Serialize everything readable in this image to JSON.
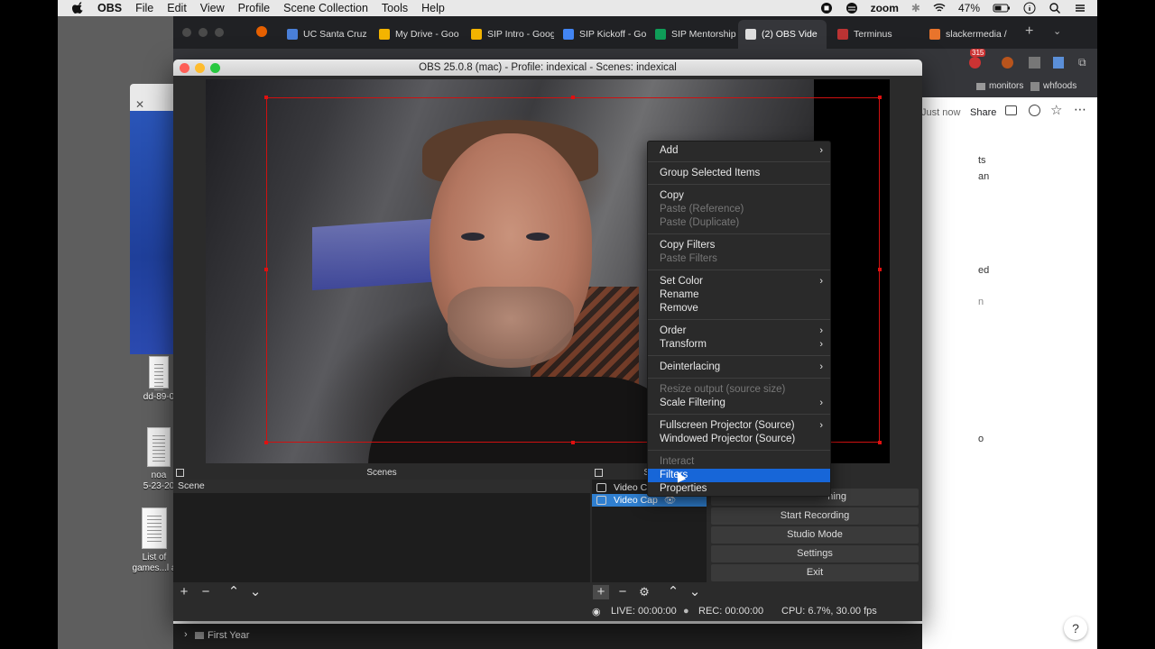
{
  "menubar": {
    "app": "OBS",
    "items": [
      "File",
      "Edit",
      "View",
      "Profile",
      "Scene Collection",
      "Tools",
      "Help"
    ],
    "zoom": "zoom",
    "battery": "47%"
  },
  "desktop": {
    "item1": "dd-89-0",
    "item2a": "noa",
    "item2b": "5-23-20",
    "item3a": "List of",
    "item3b": "games...l a"
  },
  "chrome": {
    "tabs": [
      {
        "label": "UC Santa Cruz",
        "color": "#4a7fd8"
      },
      {
        "label": "My Drive - Goo",
        "color": "#f4b400"
      },
      {
        "label": "SIP Intro - Goog",
        "color": "#f4b400"
      },
      {
        "label": "SIP Kickoff - Go",
        "color": "#4285f4"
      },
      {
        "label": "SIP Mentorship",
        "color": "#0f9d58"
      },
      {
        "label": "(2) OBS Vide",
        "color": "#aaaaaa"
      },
      {
        "label": "Terminus",
        "color": "#b33"
      },
      {
        "label": "slackermedia / ",
        "color": "#e8742c"
      }
    ],
    "bookmarks": [
      "monitors",
      "whfoods"
    ],
    "badge": "315",
    "just_now": "Just now",
    "share": "Share",
    "fragments": [
      "ts",
      "an",
      "ed",
      "n",
      "o"
    ],
    "drive_item": "First Year",
    "help": "?"
  },
  "obs": {
    "title": "OBS 25.0.8 (mac) - Profile: indexical - Scenes: indexical",
    "panels": {
      "scenes": "Scenes",
      "sources": "So",
      "controls": "ls"
    },
    "scene": "Scene",
    "sources": [
      "Video C",
      "Video Cap"
    ],
    "controls": [
      "ning",
      "Start Recording",
      "Studio Mode",
      "Settings",
      "Exit"
    ],
    "status": {
      "live": "LIVE: 00:00:00",
      "rec": "REC: 00:00:00",
      "cpu": "CPU: 6.7%, 30.00 fps"
    }
  },
  "context_menu": {
    "items": [
      {
        "label": "Add",
        "sub": true,
        "disabled": false
      },
      {
        "label": "Group Selected Items",
        "sub": false,
        "disabled": false
      },
      {
        "label": "Copy",
        "sub": false,
        "disabled": false
      },
      {
        "label": "Paste (Reference)",
        "sub": false,
        "disabled": true
      },
      {
        "label": "Paste (Duplicate)",
        "sub": false,
        "disabled": true
      },
      {
        "label": "Copy Filters",
        "sub": false,
        "disabled": false
      },
      {
        "label": "Paste Filters",
        "sub": false,
        "disabled": true
      },
      {
        "label": "Set Color",
        "sub": true,
        "disabled": false
      },
      {
        "label": "Rename",
        "sub": false,
        "disabled": false
      },
      {
        "label": "Remove",
        "sub": false,
        "disabled": false
      },
      {
        "label": "Order",
        "sub": true,
        "disabled": false
      },
      {
        "label": "Transform",
        "sub": true,
        "disabled": false
      },
      {
        "label": "Deinterlacing",
        "sub": true,
        "disabled": false
      },
      {
        "label": "Resize output (source size)",
        "sub": false,
        "disabled": true
      },
      {
        "label": "Scale Filtering",
        "sub": true,
        "disabled": false
      },
      {
        "label": "Fullscreen Projector (Source)",
        "sub": true,
        "disabled": false
      },
      {
        "label": "Windowed Projector (Source)",
        "sub": false,
        "disabled": false
      },
      {
        "label": "Interact",
        "sub": false,
        "disabled": true
      },
      {
        "label": "Filters",
        "sub": false,
        "disabled": false,
        "highlighted": true
      },
      {
        "label": "Properties",
        "sub": false,
        "disabled": false
      }
    ],
    "arrow": "›"
  }
}
